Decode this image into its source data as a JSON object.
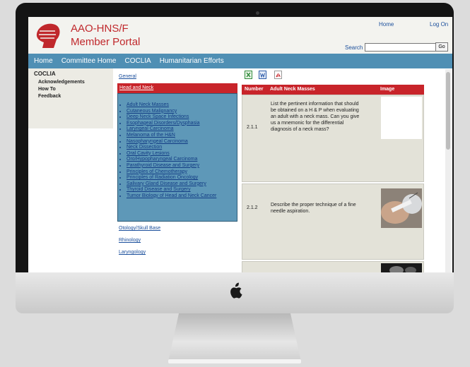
{
  "header": {
    "title_line1": "AAO-HNS/F",
    "title_line2": "Member Portal",
    "home_link": "Home",
    "logon_link": "Log On",
    "search_label": "Search",
    "search_value": "",
    "go_label": "Go"
  },
  "nav": [
    "Home",
    "Committee Home",
    "COCLIA",
    "Humanitarian Efforts"
  ],
  "sidebar": {
    "heading": "COCLIA",
    "items": [
      "Acknowledgements",
      "How To",
      "Feedback"
    ]
  },
  "topics": {
    "general": "General",
    "selected": "Head and Neck",
    "sublinks": [
      "Adult Neck Masses",
      "Cutaneous Malignancy",
      "Deep Neck Space Infections",
      "Esophageal Disorders/Dysphasia",
      "Laryngeal Carcinoma",
      "Melanoma of the H&N",
      "Nasopharyngeal Carcinoma",
      "Neck Dissection",
      "Oral Cavity Lesions",
      "Oro/Hypopharyngeal Carcinoma",
      "Parathyroid Disease and Surgery",
      "Principles of Chemotherapy",
      "Principles of Radiation Oncology",
      "Salivary Gland Disease and Surgery",
      "Thyroid Disease and Surgery",
      "Tumor Biology of Head and Neck Cancer"
    ],
    "after": [
      "Otology/Skull Base",
      "Rhinology",
      "Laryngology"
    ]
  },
  "toolbar_icons": [
    "excel-icon",
    "word-icon",
    "pdf-icon"
  ],
  "table": {
    "col_number": "Number",
    "col_title": "Adult Neck Masses",
    "col_image": "Image",
    "rows": [
      {
        "num": "2.1.1",
        "text": "List the pertinent information that should be obtained on a H & P when evaluating an adult with a neck mass. Can you give us a mnemonic for the differential diagnosis of a neck mass?"
      },
      {
        "num": "2.1.2",
        "text": "Describe the proper technique of a fine needle aspiration."
      }
    ]
  },
  "colors": {
    "accent_red": "#c8242a",
    "nav_blue": "#4f8fb4",
    "link_blue": "#1b4f9c"
  }
}
